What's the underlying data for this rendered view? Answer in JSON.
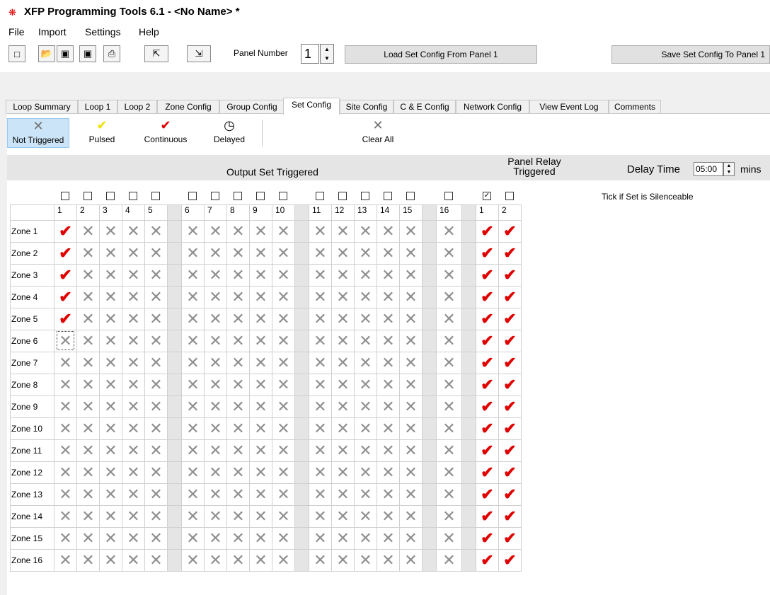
{
  "window": {
    "title": "XFP Programming Tools 6.1 - <No Name> *"
  },
  "menu": [
    "File",
    "Import",
    "Settings",
    "Help"
  ],
  "toolbar": {
    "panel_label": "Panel Number",
    "panel_number": "1",
    "load_button": "Load Set Config From Panel 1",
    "save_button": "Save Set Config To Panel 1"
  },
  "tabs": [
    "Loop Summary",
    "Loop 1",
    "Loop 2",
    "Zone Config",
    "Group Config",
    "Set Config",
    "Site Config",
    "C & E Config",
    "Network Config",
    "View Event Log",
    "Comments"
  ],
  "active_tab": "Set Config",
  "modes": [
    "Not Triggered",
    "Pulsed",
    "Continuous",
    "Delayed",
    "Clear All"
  ],
  "header": {
    "output_label": "Output Set Triggered",
    "relay_label_1": "Panel Relay",
    "relay_label_2": "Triggered",
    "delay_label": "Delay Time",
    "delay_value": "05:00",
    "delay_unit": "mins"
  },
  "silence_label": "Tick if Set is Silenceable",
  "silence_checked": [
    false,
    false,
    false,
    false,
    false,
    false,
    false,
    false,
    false,
    false,
    false,
    false,
    false,
    false,
    false,
    false,
    true,
    false
  ],
  "columns": [
    "1",
    "2",
    "3",
    "4",
    "5",
    "6",
    "7",
    "8",
    "9",
    "10",
    "11",
    "12",
    "13",
    "14",
    "15",
    "16",
    "1",
    "2"
  ],
  "rows": [
    {
      "label": "Zone 1",
      "cells": "CXXXXXXXXXXXXXXXCC"
    },
    {
      "label": "Zone 2",
      "cells": "CXXXXXXXXXXXXXXXCC"
    },
    {
      "label": "Zone 3",
      "cells": "CXXXXXXXXXXXXXXXCC"
    },
    {
      "label": "Zone 4",
      "cells": "CXXXXXXXXXXXXXXXCC"
    },
    {
      "label": "Zone 5",
      "cells": "CXXXXXXXXXXXXXXXCC"
    },
    {
      "label": "Zone 6",
      "cells": "XXXXXXXXXXXXXXXXCC"
    },
    {
      "label": "Zone 7",
      "cells": "XXXXXXXXXXXXXXXXCC"
    },
    {
      "label": "Zone 8",
      "cells": "XXXXXXXXXXXXXXXXCC"
    },
    {
      "label": "Zone 9",
      "cells": "XXXXXXXXXXXXXXXXCC"
    },
    {
      "label": "Zone 10",
      "cells": "XXXXXXXXXXXXXXXXCC"
    },
    {
      "label": "Zone 11",
      "cells": "XXXXXXXXXXXXXXXXCC"
    },
    {
      "label": "Zone 12",
      "cells": "XXXXXXXXXXXXXXXXCC"
    },
    {
      "label": "Zone 13",
      "cells": "XXXXXXXXXXXXXXXXCC"
    },
    {
      "label": "Zone 14",
      "cells": "XXXXXXXXXXXXXXXXCC"
    },
    {
      "label": "Zone 15",
      "cells": "XXXXXXXXXXXXXXXXCC"
    },
    {
      "label": "Zone 16",
      "cells": "XXXXXXXXXXXXXXXXCC"
    }
  ],
  "colors": {
    "tick": "#e00000",
    "cross": "#8e8e8e",
    "pulsed": "#f0e000",
    "active_mode": "#cce4f7"
  },
  "icons": {
    "not_triggered": "cross-icon",
    "pulsed": "yellow-tick-icon",
    "continuous": "red-tick-icon",
    "delayed": "clock-icon",
    "clear_all": "cross-icon"
  }
}
